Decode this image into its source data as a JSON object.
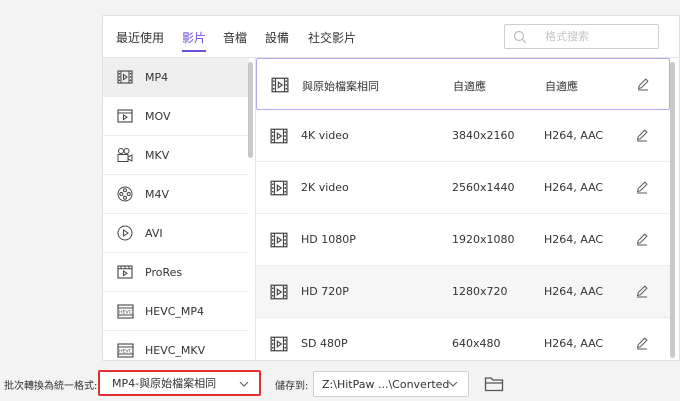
{
  "tabs": [
    {
      "label": "最近使用",
      "active": false
    },
    {
      "label": "影片",
      "active": true
    },
    {
      "label": "音檔",
      "active": false
    },
    {
      "label": "設備",
      "active": false
    },
    {
      "label": "社交影片",
      "active": false
    }
  ],
  "search": {
    "placeholder": "格式搜索"
  },
  "formats": [
    {
      "label": "MP4",
      "icon": "film-icon",
      "selected": true
    },
    {
      "label": "MOV",
      "icon": "mov-icon",
      "selected": false
    },
    {
      "label": "MKV",
      "icon": "video-camera-icon",
      "selected": false
    },
    {
      "label": "M4V",
      "icon": "film-reel-icon",
      "selected": false
    },
    {
      "label": "AVI",
      "icon": "play-circle-icon",
      "selected": false
    },
    {
      "label": "ProRes",
      "icon": "prores-icon",
      "selected": false
    },
    {
      "label": "HEVC_MP4",
      "icon": "hevc-icon",
      "selected": false
    },
    {
      "label": "HEVC_MKV",
      "icon": "hevc-icon",
      "selected": false
    }
  ],
  "presets": [
    {
      "name": "與原始檔案相同",
      "resolution": "自適應",
      "codec": "自適應",
      "selected": true
    },
    {
      "name": "4K video",
      "resolution": "3840x2160",
      "codec": "H264, AAC",
      "selected": false
    },
    {
      "name": "2K video",
      "resolution": "2560x1440",
      "codec": "H264, AAC",
      "selected": false
    },
    {
      "name": "HD 1080P",
      "resolution": "1920x1080",
      "codec": "H264, AAC",
      "selected": false
    },
    {
      "name": "HD 720P",
      "resolution": "1280x720",
      "codec": "H264, AAC",
      "selected": false
    },
    {
      "name": "SD 480P",
      "resolution": "640x480",
      "codec": "H264, AAC",
      "selected": false
    }
  ],
  "bottom": {
    "convert_label": "批次轉換為統一格式:",
    "convert_value": "MP4-與原始檔案相同",
    "save_label": "儲存到:",
    "save_value": "Z:\\HitPaw ...\\Converted"
  },
  "colors": {
    "accent": "#6e4ddc",
    "highlight_border": "#e03030",
    "selected_border": "#b9a6ee"
  }
}
